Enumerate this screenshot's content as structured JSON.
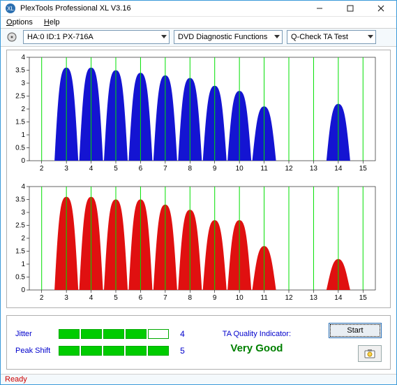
{
  "window": {
    "title": "PlexTools Professional XL V3.16"
  },
  "menu": {
    "options": "Options",
    "help": "Help"
  },
  "toolbar": {
    "drive": "HA:0 ID:1  PX-716A",
    "func": "DVD Diagnostic Functions",
    "test": "Q-Check TA Test"
  },
  "chart_data": [
    {
      "type": "bar",
      "color": "#1414d2",
      "title": "",
      "xlabel": "",
      "ylabel": "",
      "ylim": [
        0,
        4
      ],
      "yticks": [
        0,
        0.5,
        1,
        1.5,
        2,
        2.5,
        3,
        3.5,
        4
      ],
      "xticks": [
        2,
        3,
        4,
        5,
        6,
        7,
        8,
        9,
        10,
        11,
        12,
        13,
        14,
        15
      ],
      "series": [
        {
          "center": 3,
          "peak": 3.6
        },
        {
          "center": 4,
          "peak": 3.6
        },
        {
          "center": 5,
          "peak": 3.5
        },
        {
          "center": 6,
          "peak": 3.4
        },
        {
          "center": 7,
          "peak": 3.3
        },
        {
          "center": 8,
          "peak": 3.2
        },
        {
          "center": 9,
          "peak": 2.9
        },
        {
          "center": 10,
          "peak": 2.7
        },
        {
          "center": 11,
          "peak": 2.1
        },
        {
          "center": 14,
          "peak": 2.2
        }
      ]
    },
    {
      "type": "bar",
      "color": "#e01010",
      "title": "",
      "xlabel": "",
      "ylabel": "",
      "ylim": [
        0,
        4
      ],
      "yticks": [
        0,
        0.5,
        1,
        1.5,
        2,
        2.5,
        3,
        3.5,
        4
      ],
      "xticks": [
        2,
        3,
        4,
        5,
        6,
        7,
        8,
        9,
        10,
        11,
        12,
        13,
        14,
        15
      ],
      "series": [
        {
          "center": 3,
          "peak": 3.6
        },
        {
          "center": 4,
          "peak": 3.6
        },
        {
          "center": 5,
          "peak": 3.5
        },
        {
          "center": 6,
          "peak": 3.5
        },
        {
          "center": 7,
          "peak": 3.3
        },
        {
          "center": 8,
          "peak": 3.1
        },
        {
          "center": 9,
          "peak": 2.7
        },
        {
          "center": 10,
          "peak": 2.7
        },
        {
          "center": 11,
          "peak": 1.7
        },
        {
          "center": 14,
          "peak": 1.2
        }
      ]
    }
  ],
  "metrics": {
    "jitter_label": "Jitter",
    "jitter_bars": 4,
    "jitter_max": 5,
    "jitter_value": "4",
    "peakshift_label": "Peak Shift",
    "peakshift_bars": 5,
    "peakshift_max": 5,
    "peakshift_value": "5",
    "ta_label": "TA Quality Indicator:",
    "ta_value": "Very Good",
    "start_label": "Start"
  },
  "status": {
    "text": "Ready"
  }
}
